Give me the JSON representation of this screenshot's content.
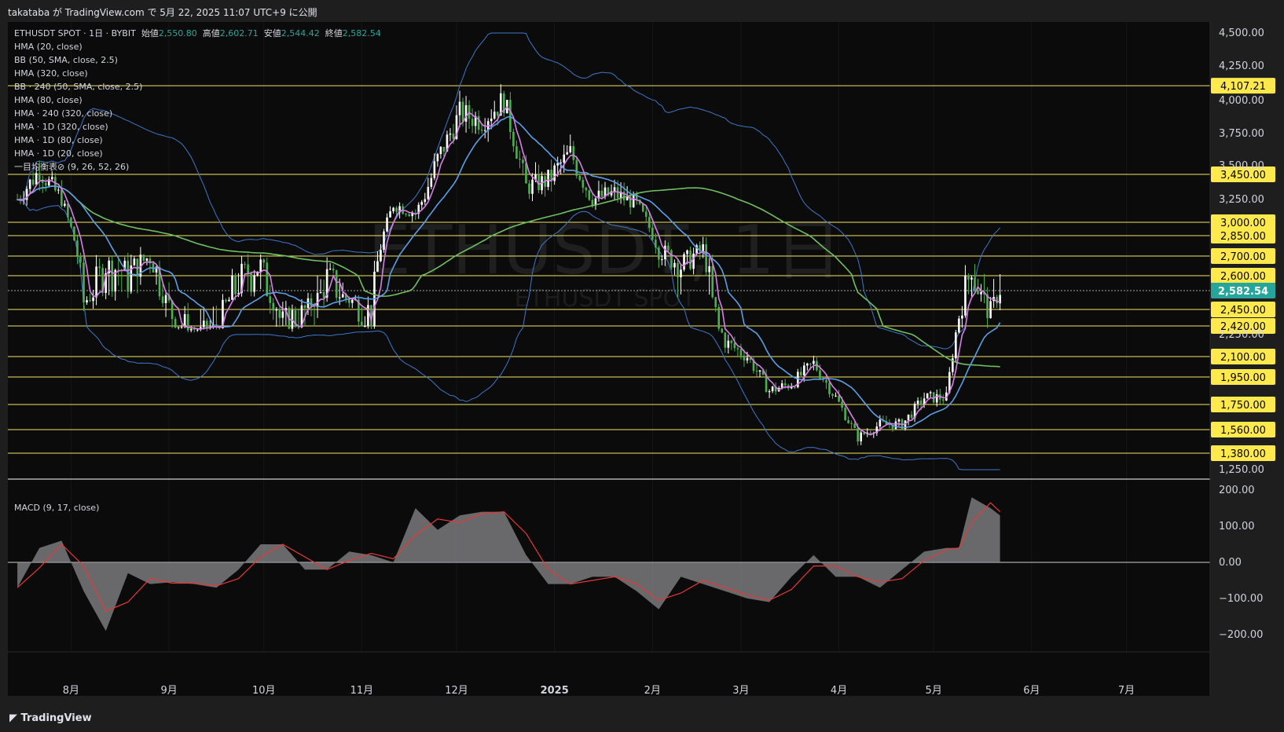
{
  "header": {
    "publish_line": "takataba が TradingView.com で 5月 22, 2025 11:07 UTC+9 に公開"
  },
  "legend": {
    "symbol_line": "ETHUSDT SPOT · 1日 · BYBIT",
    "open_label": "始値",
    "open": "2,550.80",
    "high_label": "高値",
    "high": "2,602.71",
    "low_label": "安値",
    "low": "2,544.42",
    "close_label": "終値",
    "close": "2,582.54",
    "indicators": [
      "HMA (20, close)",
      "BB (50, SMA, close, 2.5)",
      "HMA (320, close)",
      "BB · 240 (50, SMA, close, 2.5)",
      "HMA (80, close)",
      "HMA · 240 (320, close)",
      "HMA · 1D (320, close)",
      "HMA · 1D (80, close)",
      "HMA · 1D (20, close)",
      "一目均衡表⊘ (9, 26, 52, 26)"
    ]
  },
  "watermark": {
    "main": "ETHUSDT, 1日",
    "sub": "ETHUSDT SPOT"
  },
  "macd_label": "MACD (9, 17, close)",
  "footer": {
    "brand": "TradingView"
  },
  "colors": {
    "background": "#0b0b0b",
    "up": "#ffffff",
    "down": "#4caf50",
    "level_line": "#f5e663",
    "level_bg": "#ffe94d",
    "price_bg": "#26a69a",
    "hma20": "#d97ee8",
    "hma80": "#5a9fe6",
    "hma320": "#6fbf5f",
    "bb": "#3c77c8",
    "cloud": "#6b6b6b",
    "macd_hist": "#8a8a8e",
    "macd_signal": "#e53935"
  },
  "chart_data": [
    {
      "type": "candlestick",
      "title": "ETHUSDT SPOT · 1日 · BYBIT",
      "x_tick_labels": [
        "8月",
        "9月",
        "10月",
        "11月",
        "12月",
        "2025",
        "2月",
        "3月",
        "4月",
        "5月",
        "6月",
        "7月"
      ],
      "y_tick_labels": [
        "4,500.00",
        "4,250.00",
        "4,000.00",
        "3,750.00",
        "3,500.00",
        "3,250.00",
        "2,250.00",
        "1,250.00"
      ],
      "ylim": [
        1250,
        4500
      ],
      "horizontal_levels": [
        {
          "value": 4107.21,
          "label": "4,107.21"
        },
        {
          "value": 3450,
          "label": "3,450.00"
        },
        {
          "value": 3000,
          "label": "3,000.00"
        },
        {
          "value": 2850,
          "label": "2,850.00"
        },
        {
          "value": 2700,
          "label": "2,700.00"
        },
        {
          "value": 2600,
          "label": "2,600.00"
        },
        {
          "value": 2450,
          "label": "2,450.00"
        },
        {
          "value": 2420,
          "label": "2,420.00"
        },
        {
          "value": 2100,
          "label": "2,100.00"
        },
        {
          "value": 1950,
          "label": "1,950.00"
        },
        {
          "value": 1750,
          "label": "1,750.00"
        },
        {
          "value": 1560,
          "label": "1,560.00"
        },
        {
          "value": 1380,
          "label": "1,380.00"
        }
      ],
      "last_price": {
        "value": 2582.54,
        "label": "2,582.54"
      },
      "close_path": [
        {
          "date": "2024-07-15",
          "close": 3250
        },
        {
          "date": "2024-07-22",
          "close": 3480
        },
        {
          "date": "2024-07-29",
          "close": 3250
        },
        {
          "date": "2024-08-05",
          "close": 2500
        },
        {
          "date": "2024-08-12",
          "close": 2650
        },
        {
          "date": "2024-08-19",
          "close": 2620
        },
        {
          "date": "2024-08-26",
          "close": 2700
        },
        {
          "date": "2024-09-02",
          "close": 2450
        },
        {
          "date": "2024-09-09",
          "close": 2350
        },
        {
          "date": "2024-09-16",
          "close": 2400
        },
        {
          "date": "2024-09-23",
          "close": 2600
        },
        {
          "date": "2024-09-30",
          "close": 2650
        },
        {
          "date": "2024-10-07",
          "close": 2400
        },
        {
          "date": "2024-10-14",
          "close": 2450
        },
        {
          "date": "2024-10-21",
          "close": 2600
        },
        {
          "date": "2024-10-28",
          "close": 2520
        },
        {
          "date": "2024-11-04",
          "close": 2450
        },
        {
          "date": "2024-11-11",
          "close": 3200
        },
        {
          "date": "2024-11-18",
          "close": 3100
        },
        {
          "date": "2024-11-25",
          "close": 3550
        },
        {
          "date": "2024-12-02",
          "close": 3900
        },
        {
          "date": "2024-12-09",
          "close": 3850
        },
        {
          "date": "2024-12-16",
          "close": 4000
        },
        {
          "date": "2024-12-23",
          "close": 3350
        },
        {
          "date": "2024-12-30",
          "close": 3400
        },
        {
          "date": "2025-01-06",
          "close": 3600
        },
        {
          "date": "2025-01-13",
          "close": 3250
        },
        {
          "date": "2025-01-20",
          "close": 3300
        },
        {
          "date": "2025-01-27",
          "close": 3200
        },
        {
          "date": "2025-02-03",
          "close": 2750
        },
        {
          "date": "2025-02-10",
          "close": 2650
        },
        {
          "date": "2025-02-17",
          "close": 2750
        },
        {
          "date": "2025-02-24",
          "close": 2200
        },
        {
          "date": "2025-03-03",
          "close": 2100
        },
        {
          "date": "2025-03-10",
          "close": 1850
        },
        {
          "date": "2025-03-17",
          "close": 1900
        },
        {
          "date": "2025-03-24",
          "close": 2050
        },
        {
          "date": "2025-03-31",
          "close": 1800
        },
        {
          "date": "2025-04-07",
          "close": 1500
        },
        {
          "date": "2025-04-14",
          "close": 1600
        },
        {
          "date": "2025-04-21",
          "close": 1600
        },
        {
          "date": "2025-04-28",
          "close": 1800
        },
        {
          "date": "2025-05-05",
          "close": 1800
        },
        {
          "date": "2025-05-09",
          "close": 2450
        },
        {
          "date": "2025-05-13",
          "close": 2650
        },
        {
          "date": "2025-05-19",
          "close": 2450
        },
        {
          "date": "2025-05-22",
          "close": 2582.54
        }
      ]
    },
    {
      "type": "area",
      "title": "MACD (9, 17, close)",
      "y_tick_labels": [
        "200.00",
        "100.00",
        "0.00",
        "−100.00",
        "−200.00"
      ],
      "ylim": [
        -200,
        200
      ],
      "series": [
        {
          "values": [
            -70,
            40,
            60,
            -80,
            -190,
            -30,
            -60,
            -55,
            -60,
            -70,
            -20,
            50,
            50,
            -20,
            -20,
            30,
            20,
            0,
            150,
            90,
            130,
            140,
            140,
            20,
            -60,
            -60,
            -40,
            -40,
            -80,
            -130,
            -40,
            -60,
            -80,
            -100,
            -110,
            -40,
            20,
            -40,
            -40,
            -70,
            -20,
            30,
            40,
            40,
            180,
            150,
            130
          ]
        }
      ]
    }
  ]
}
